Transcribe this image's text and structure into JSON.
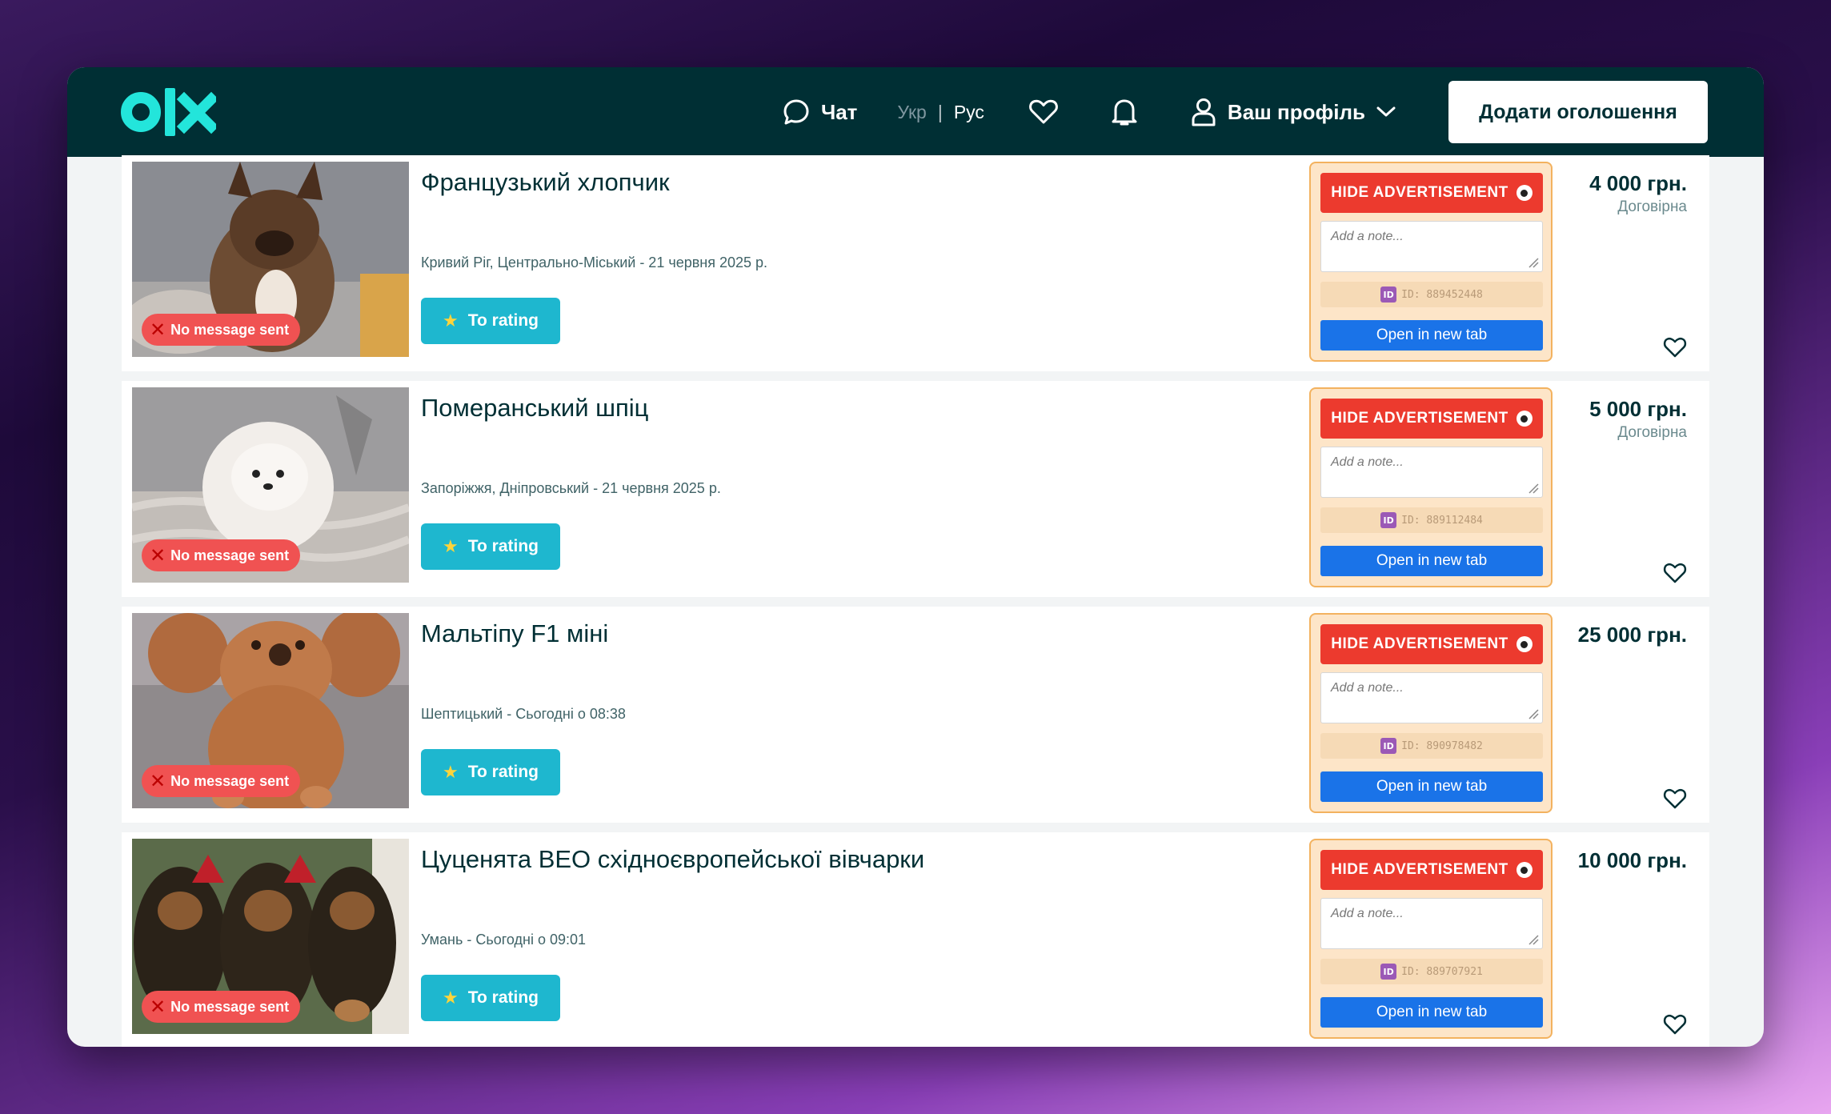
{
  "header": {
    "logo_text": "olx",
    "chat_label": "Чат",
    "lang_uk": "Укр",
    "lang_separator": "|",
    "lang_ru": "Рус",
    "profile_label": "Ваш профіль",
    "add_ad_label": "Додати оголошення"
  },
  "colors": {
    "topbar": "#002f34",
    "accent": "#23e5db",
    "hide_button": "#ec3a2e",
    "open_button": "#1a73e8",
    "rating_button": "#1eb7cf"
  },
  "listings": [
    {
      "title": "Французький хлопчик",
      "location": "Кривий Ріг, Центрально-Міський - 21 червня 2025 р.",
      "price": "4 000 грн.",
      "negotiable": "Договірна",
      "no_message": "No message sent",
      "rating_label": "To rating",
      "hide_label": "HIDE ADVERTISEMENT",
      "note_placeholder": "Add a note...",
      "id_text": "ID: 889452448",
      "open_label": "Open in new tab"
    },
    {
      "title": "Померанський шпіц",
      "location": "Запоріжжя, Дніпровський - 21 червня 2025 р.",
      "price": "5 000 грн.",
      "negotiable": "Договірна",
      "no_message": "No message sent",
      "rating_label": "To rating",
      "hide_label": "HIDE ADVERTISEMENT",
      "note_placeholder": "Add a note...",
      "id_text": "ID: 889112484",
      "open_label": "Open in new tab"
    },
    {
      "title": "Мальтіпу F1 міні",
      "location": "Шептицький - Сьогодні о 08:38",
      "price": "25 000 грн.",
      "negotiable": "",
      "no_message": "No message sent",
      "rating_label": "To rating",
      "hide_label": "HIDE ADVERTISEMENT",
      "note_placeholder": "Add a note...",
      "id_text": "ID: 890978482",
      "open_label": "Open in new tab"
    },
    {
      "title": "Цуценята ВЕО східноєвропейської вівчарки",
      "location": "Умань - Сьогодні о 09:01",
      "price": "10 000 грн.",
      "negotiable": "",
      "no_message": "No message sent",
      "rating_label": "To rating",
      "hide_label": "HIDE ADVERTISEMENT",
      "note_placeholder": "Add a note...",
      "id_text": "ID: 889707921",
      "open_label": "Open in new tab"
    }
  ]
}
